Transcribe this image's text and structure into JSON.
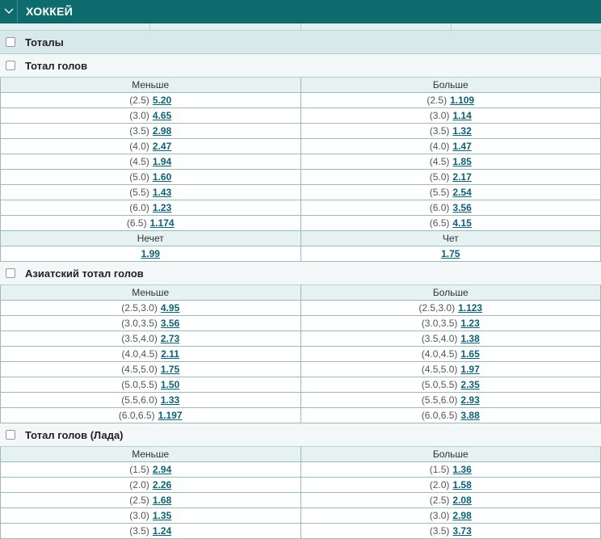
{
  "header": {
    "title": "ХОККЕЙ"
  },
  "sections": {
    "totals": {
      "label": "Тоталы"
    },
    "total_goals": {
      "label": "Тотал голов",
      "col_under": "Меньше",
      "col_over": "Больше",
      "rows": [
        {
          "p_u": "(2.5)",
          "o_u": "5.20",
          "p_o": "(2.5)",
          "o_o": "1.109"
        },
        {
          "p_u": "(3.0)",
          "o_u": "4.65",
          "p_o": "(3.0)",
          "o_o": "1.14"
        },
        {
          "p_u": "(3.5)",
          "o_u": "2.98",
          "p_o": "(3.5)",
          "o_o": "1.32"
        },
        {
          "p_u": "(4.0)",
          "o_u": "2.47",
          "p_o": "(4.0)",
          "o_o": "1.47"
        },
        {
          "p_u": "(4.5)",
          "o_u": "1.94",
          "p_o": "(4.5)",
          "o_o": "1.85"
        },
        {
          "p_u": "(5.0)",
          "o_u": "1.60",
          "p_o": "(5.0)",
          "o_o": "2.17"
        },
        {
          "p_u": "(5.5)",
          "o_u": "1.43",
          "p_o": "(5.5)",
          "o_o": "2.54"
        },
        {
          "p_u": "(6.0)",
          "o_u": "1.23",
          "p_o": "(6.0)",
          "o_o": "3.56"
        },
        {
          "p_u": "(6.5)",
          "o_u": "1.174",
          "p_o": "(6.5)",
          "o_o": "4.15"
        }
      ],
      "odd_label": "Нечет",
      "even_label": "Чет",
      "odd_value": "1.99",
      "even_value": "1.75"
    },
    "asian_total": {
      "label": "Азиатский тотал голов",
      "col_under": "Меньше",
      "col_over": "Больше",
      "rows": [
        {
          "p_u": "(2.5,3.0)",
          "o_u": "4.95",
          "p_o": "(2.5,3.0)",
          "o_o": "1.123"
        },
        {
          "p_u": "(3.0,3.5)",
          "o_u": "3.56",
          "p_o": "(3.0,3.5)",
          "o_o": "1.23"
        },
        {
          "p_u": "(3.5,4.0)",
          "o_u": "2.73",
          "p_o": "(3.5,4.0)",
          "o_o": "1.38"
        },
        {
          "p_u": "(4.0,4.5)",
          "o_u": "2.11",
          "p_o": "(4.0,4.5)",
          "o_o": "1.65"
        },
        {
          "p_u": "(4.5,5.0)",
          "o_u": "1.75",
          "p_o": "(4.5,5.0)",
          "o_o": "1.97"
        },
        {
          "p_u": "(5.0,5.5)",
          "o_u": "1.50",
          "p_o": "(5.0,5.5)",
          "o_o": "2.35"
        },
        {
          "p_u": "(5.5,6.0)",
          "o_u": "1.33",
          "p_o": "(5.5,6.0)",
          "o_o": "2.93"
        },
        {
          "p_u": "(6.0,6.5)",
          "o_u": "1.197",
          "p_o": "(6.0,6.5)",
          "o_o": "3.88"
        }
      ]
    },
    "total_lada": {
      "label": "Тотал голов (Лада)",
      "col_under": "Меньше",
      "col_over": "Больше",
      "rows": [
        {
          "p_u": "(1.5)",
          "o_u": "2.94",
          "p_o": "(1.5)",
          "o_o": "1.36"
        },
        {
          "p_u": "(2.0)",
          "o_u": "2.26",
          "p_o": "(2.0)",
          "o_o": "1.58"
        },
        {
          "p_u": "(2.5)",
          "o_u": "1.68",
          "p_o": "(2.5)",
          "o_o": "2.08"
        },
        {
          "p_u": "(3.0)",
          "o_u": "1.35",
          "p_o": "(3.0)",
          "o_o": "2.98"
        },
        {
          "p_u": "(3.5)",
          "o_u": "1.24",
          "p_o": "(3.5)",
          "o_o": "3.73"
        }
      ]
    }
  }
}
